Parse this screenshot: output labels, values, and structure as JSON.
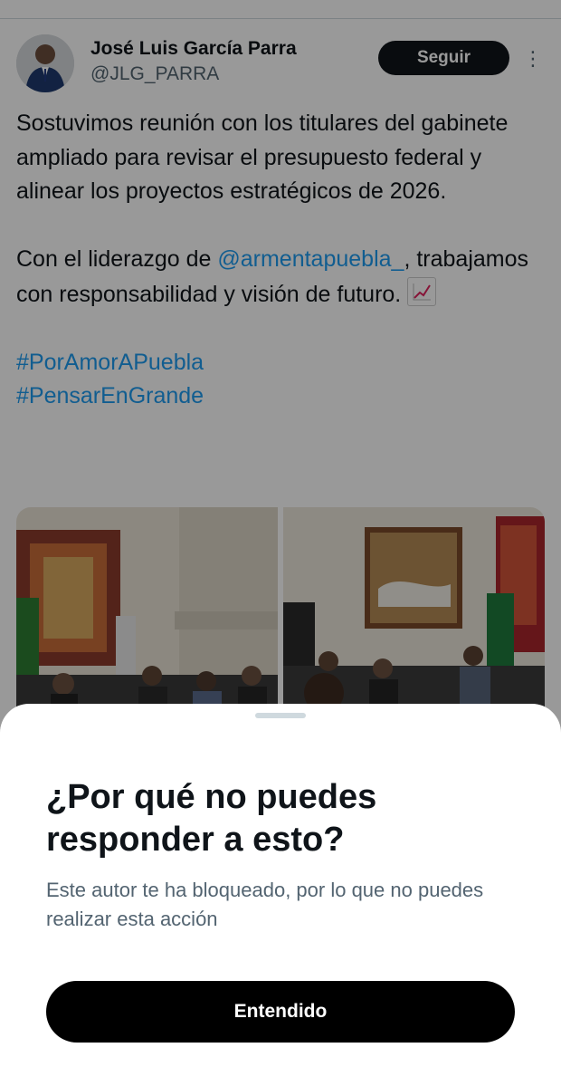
{
  "profile": {
    "name": "José Luis García Parra",
    "handle": "@JLG_PARRA",
    "follow_label": "Seguir",
    "more_icon": "⋮"
  },
  "tweet": {
    "line1": "Sostuvimos reunión con los titulares del gabinete ampliado para revisar el presupuesto federal y alinear los proyectos estratégicos de 2026.",
    "line2_prefix": "Con el liderazgo de ",
    "mention": "@armentapuebla_",
    "line2_suffix": ", trabajamos con responsabilidad y visión de futuro.",
    "emoji": "chart-increasing-icon",
    "hashtag1": "#PorAmorAPuebla",
    "hashtag2": "#PensarEnGrande"
  },
  "sheet": {
    "title": "¿Por qué no puedes responder a esto?",
    "body": "Este autor te ha bloqueado, por lo que no puedes realizar esta acción",
    "button_label": "Entendido"
  },
  "colors": {
    "link": "#1d9bf0",
    "overlay": "rgba(0,0,0,0.4)",
    "button": "#000000"
  }
}
